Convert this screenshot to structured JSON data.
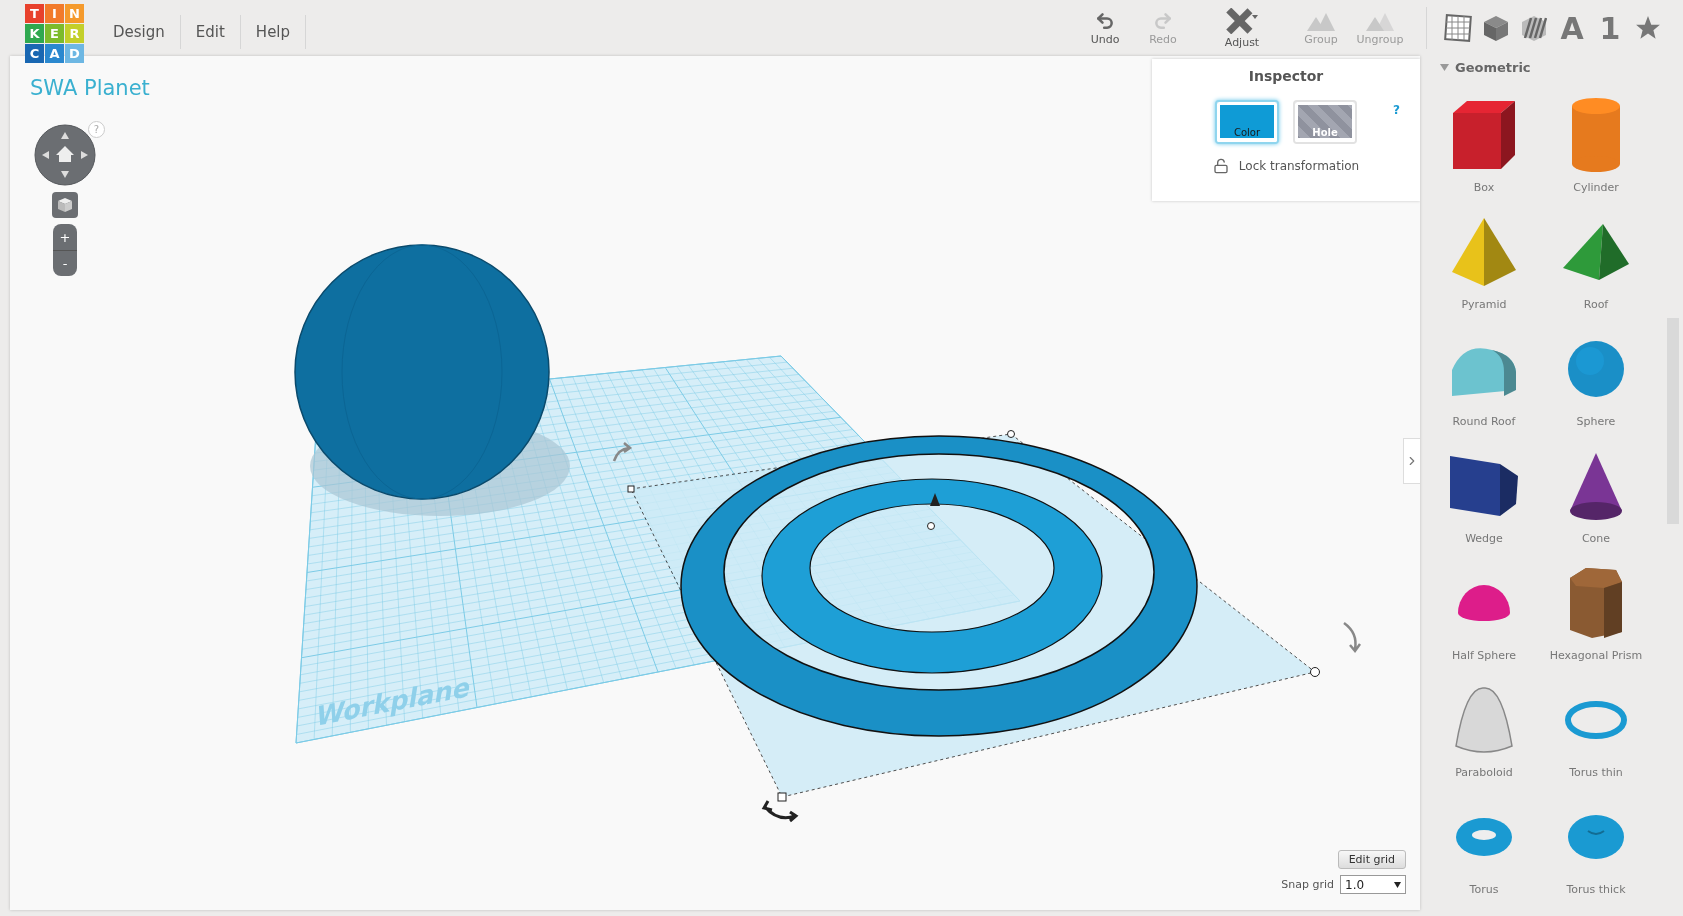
{
  "logo": [
    {
      "letter": "T",
      "color": "#e8412c"
    },
    {
      "letter": "I",
      "color": "#f27a2a"
    },
    {
      "letter": "N",
      "color": "#f59a2c"
    },
    {
      "letter": "K",
      "color": "#2fa84f"
    },
    {
      "letter": "E",
      "color": "#7dbb2c"
    },
    {
      "letter": "R",
      "color": "#c3cf2b"
    },
    {
      "letter": "C",
      "color": "#1967b2"
    },
    {
      "letter": "A",
      "color": "#2a88cf"
    },
    {
      "letter": "D",
      "color": "#6db7e3"
    }
  ],
  "menu": [
    "Design",
    "Edit",
    "Help"
  ],
  "toolbar": [
    {
      "kind": "undo",
      "label": "Undo",
      "disabled": false
    },
    {
      "kind": "redo",
      "label": "Redo",
      "disabled": true
    },
    {
      "kind": "adjust",
      "label": "Adjust",
      "disabled": false
    },
    {
      "kind": "group",
      "label": "Group",
      "disabled": true
    },
    {
      "kind": "ungroup",
      "label": "Ungroup",
      "disabled": true
    }
  ],
  "shape_categories": [
    {
      "kind": "grid"
    },
    {
      "kind": "cube"
    },
    {
      "kind": "striped-cube"
    },
    {
      "kind": "glyph",
      "label": "A"
    },
    {
      "kind": "glyph",
      "label": "1"
    },
    {
      "kind": "star"
    }
  ],
  "design_title": "SWA Planet",
  "view_controls": {
    "help": "?",
    "zoom_in": "+",
    "zoom_out": "-"
  },
  "workplane_label": "Workplane",
  "inspector": {
    "title": "Inspector",
    "help": "?",
    "options": [
      {
        "kind": "color",
        "label": "Color",
        "selected": true
      },
      {
        "kind": "hole",
        "label": "Hole",
        "selected": false
      }
    ],
    "lock_label": "Lock transformation",
    "locked": false
  },
  "grid": {
    "edit_button": "Edit grid",
    "snap_label": "Snap grid",
    "snap_value": "1.0"
  },
  "sidebar": {
    "section": "Geometric",
    "expanded": true,
    "shapes": [
      {
        "kind": "box",
        "name": "Box",
        "color": "#c8202c"
      },
      {
        "kind": "cylinder",
        "name": "Cylinder",
        "color": "#e67a1e"
      },
      {
        "kind": "pyramid",
        "name": "Pyramid",
        "color": "#e8c21a"
      },
      {
        "kind": "roof",
        "name": "Roof",
        "color": "#2e9a3a"
      },
      {
        "kind": "round-roof",
        "name": "Round Roof",
        "color": "#6cc3cf"
      },
      {
        "kind": "sphere",
        "name": "Sphere",
        "color": "#1a8fc7"
      },
      {
        "kind": "wedge",
        "name": "Wedge",
        "color": "#263f8e"
      },
      {
        "kind": "cone",
        "name": "Cone",
        "color": "#7a3595"
      },
      {
        "kind": "half-sphere",
        "name": "Half Sphere",
        "color": "#dd1d8a"
      },
      {
        "kind": "hex-prism",
        "name": "Hexagonal Prism",
        "color": "#8a5a32"
      },
      {
        "kind": "paraboloid",
        "name": "Paraboloid",
        "color": "#d8d8d8"
      },
      {
        "kind": "torus-thin",
        "name": "Torus thin",
        "color": "#1a9ad2"
      },
      {
        "kind": "torus",
        "name": "Torus",
        "color": "#1a9ad2"
      },
      {
        "kind": "torus-thick",
        "name": "Torus thick",
        "color": "#1a9ad2"
      }
    ]
  }
}
